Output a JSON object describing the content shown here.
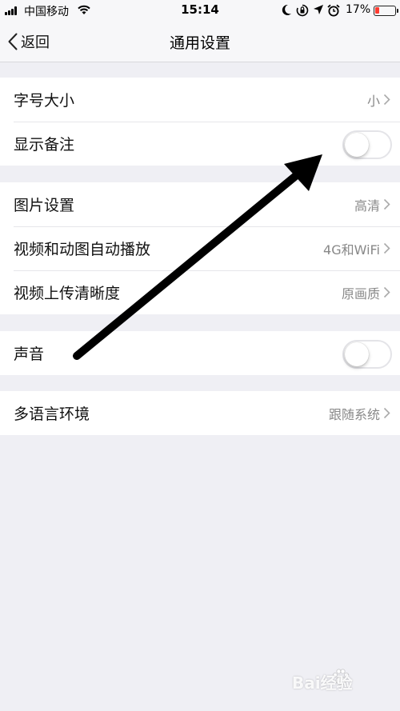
{
  "status_bar": {
    "carrier": "中国移动",
    "time": "15:14",
    "battery_percent": "17%",
    "battery_level": 0.17,
    "icons": [
      "signal-icon",
      "wifi-icon",
      "moon-icon",
      "rotation-lock-icon",
      "location-icon",
      "alarm-icon",
      "battery-icon"
    ]
  },
  "nav": {
    "back_label": "返回",
    "title": "通用设置"
  },
  "groups": [
    {
      "rows": [
        {
          "label": "字号大小",
          "value": "小",
          "type": "disclosure"
        },
        {
          "label": "显示备注",
          "type": "toggle",
          "on": false
        }
      ]
    },
    {
      "rows": [
        {
          "label": "图片设置",
          "value": "高清",
          "type": "disclosure"
        },
        {
          "label": "视频和动图自动播放",
          "value": "4G和WiFi",
          "type": "disclosure"
        },
        {
          "label": "视频上传清晰度",
          "value": "原画质",
          "type": "disclosure"
        }
      ]
    },
    {
      "rows": [
        {
          "label": "声音",
          "type": "toggle",
          "on": false
        }
      ]
    },
    {
      "rows": [
        {
          "label": "多语言环境",
          "value": "跟随系统",
          "type": "disclosure"
        }
      ]
    }
  ],
  "watermark": {
    "text": "Bai经验"
  },
  "colors": {
    "background": "#efeff4",
    "annotation_arrow": "#000000",
    "battery_low": "#ff3b30"
  }
}
